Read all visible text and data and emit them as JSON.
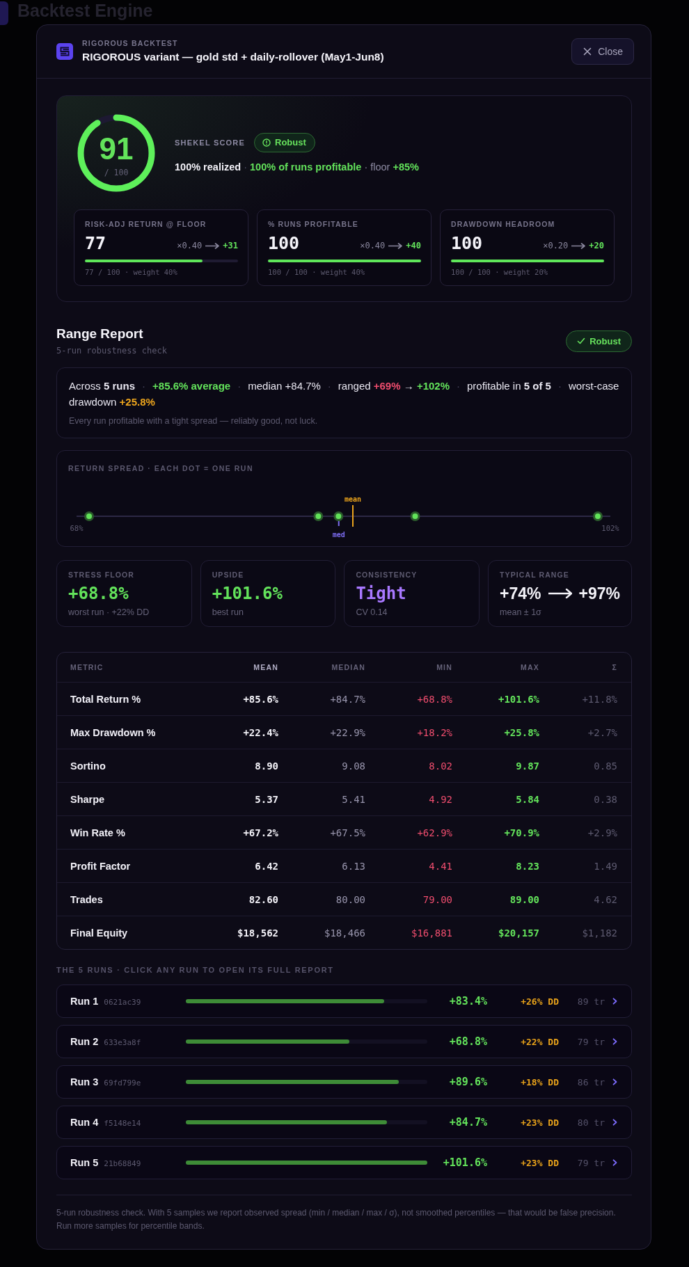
{
  "background": {
    "title": "Backtest Engine"
  },
  "modal": {
    "eyebrow": "RIGOROUS BACKTEST",
    "title": "RIGOROUS variant — gold std + daily-rollover (May1-Jun8)",
    "close": "Close"
  },
  "score": {
    "label": "SHEKEL SCORE",
    "value": "91",
    "out_of": "/ 100",
    "level": 0.91,
    "badge": "Robust",
    "summary": [
      {
        "text": "100% realized",
        "kind": "strong"
      },
      {
        "text": " · ",
        "kind": "dim"
      },
      {
        "text": "100% of runs profitable",
        "kind": "gain"
      },
      {
        "text": " · floor ",
        "kind": "muted"
      },
      {
        "text": "+85%",
        "kind": "gain"
      }
    ],
    "components": [
      {
        "label": "RISK-ADJ RETURN @ FLOOR",
        "value": "77",
        "factor": "×0.40",
        "points": "+31",
        "level": 0.77,
        "footer": "77 / 100 · weight 40%"
      },
      {
        "label": "% RUNS PROFITABLE",
        "value": "100",
        "factor": "×0.40",
        "points": "+40",
        "level": 1,
        "footer": "100 / 100 · weight 40%"
      },
      {
        "label": "DRAWDOWN HEADROOM",
        "value": "100",
        "factor": "×0.20",
        "points": "+20",
        "level": 1,
        "footer": "100 / 100 · weight 20%"
      }
    ]
  },
  "range_report": {
    "title": "Range Report",
    "subtitle": "5-run robustness check",
    "badge": "Robust",
    "summary": {
      "separator": "·",
      "segments": [
        [
          {
            "text": "Across **5 runs**",
            "kind": "plain"
          }
        ],
        [
          {
            "text": "+85.6% average",
            "kind": "gain"
          }
        ],
        [
          {
            "text": "median +84.7%",
            "kind": "plain"
          }
        ],
        [
          {
            "text": "ranged ",
            "kind": "plain"
          },
          {
            "text": "+69%",
            "kind": "loss"
          },
          {
            "text": " → ",
            "kind": "plain"
          },
          {
            "text": "+102%",
            "kind": "gain"
          }
        ],
        [
          {
            "text": "profitable in **5 of 5**",
            "kind": "plain"
          }
        ],
        [
          {
            "text": "worst-case drawdown ",
            "kind": "plain"
          },
          {
            "text": "+25.8%",
            "kind": "warn"
          }
        ]
      ],
      "note": "Every run profitable with a tight spread — reliably good, not luck."
    },
    "spread": {
      "title": "RETURN SPREAD · EACH DOT = ONE RUN",
      "min_label": "68%",
      "max_label": "102%",
      "markers": [
        {
          "label": "mean",
          "color": "#eaa31c"
        },
        {
          "label": "med",
          "color": "#7c6cf0"
        }
      ]
    },
    "stats": [
      {
        "kind": "gain",
        "label": "STRESS FLOOR",
        "value": "+68.8%",
        "caption": "worst run · +22% DD"
      },
      {
        "kind": "gain",
        "label": "UPSIDE",
        "value": "+101.6%",
        "caption": "best run"
      },
      {
        "kind": "accent",
        "label": "CONSISTENCY",
        "value": "Tight",
        "caption": "CV 0.14"
      },
      {
        "kind": "range",
        "label": "TYPICAL RANGE",
        "from": "+74%",
        "to": "+97%",
        "caption": "mean ± 1σ"
      }
    ]
  },
  "table": {
    "columns": [
      {
        "label": "METRIC",
        "kind": "label"
      },
      {
        "label": "MEAN",
        "kind": "strong"
      },
      {
        "label": "MEDIAN",
        "kind": "muted"
      },
      {
        "label": "MIN",
        "kind": "loss"
      },
      {
        "label": "MAX",
        "kind": "gain"
      },
      {
        "label": "Σ",
        "kind": "dim"
      }
    ],
    "rows": [
      {
        "metric": "Total Return %",
        "values": [
          "+85.6%",
          "+84.7%",
          "+68.8%",
          "+101.6%",
          "+11.8%"
        ]
      },
      {
        "metric": "Max Drawdown %",
        "values": [
          "+22.4%",
          "+22.9%",
          "+18.2%",
          "+25.8%",
          "+2.7%"
        ]
      },
      {
        "metric": "Sortino",
        "values": [
          "8.90",
          "9.08",
          "8.02",
          "9.87",
          "0.85"
        ]
      },
      {
        "metric": "Sharpe",
        "values": [
          "5.37",
          "5.41",
          "4.92",
          "5.84",
          "0.38"
        ]
      },
      {
        "metric": "Win Rate %",
        "values": [
          "+67.2%",
          "+67.5%",
          "+62.9%",
          "+70.9%",
          "+2.9%"
        ]
      },
      {
        "metric": "Profit Factor",
        "values": [
          "6.42",
          "6.13",
          "4.41",
          "8.23",
          "1.49"
        ]
      },
      {
        "metric": "Trades",
        "values": [
          "82.60",
          "80.00",
          "79.00",
          "89.00",
          "4.62"
        ]
      },
      {
        "metric": "Final Equity",
        "values": [
          "$18,562",
          "$18,466",
          "$16,881",
          "$20,157",
          "$1,182"
        ]
      }
    ]
  },
  "runs_heading": "THE 5 RUNS · CLICK ANY RUN TO OPEN ITS FULL REPORT",
  "runs": [
    {
      "name": "Run 1",
      "hash": "0621ac39",
      "level": 0.821,
      "return": "+83.4%",
      "drawdown": "+26% DD",
      "trades": "89 tr"
    },
    {
      "name": "Run 2",
      "hash": "633e3a8f",
      "level": 0.677,
      "return": "+68.8%",
      "drawdown": "+22% DD",
      "trades": "79 tr"
    },
    {
      "name": "Run 3",
      "hash": "69fd799e",
      "level": 0.882,
      "return": "+89.6%",
      "drawdown": "+18% DD",
      "trades": "86 tr"
    },
    {
      "name": "Run 4",
      "hash": "f5148e14",
      "level": 0.834,
      "return": "+84.7%",
      "drawdown": "+23% DD",
      "trades": "80 tr"
    },
    {
      "name": "Run 5",
      "hash": "21b68849",
      "level": 1,
      "return": "+101.6%",
      "drawdown": "+23% DD",
      "trades": "79 tr"
    }
  ],
  "footnote": "5-run robustness check. With 5 samples we report observed spread (min / median / max / σ), not smoothed percentiles — that would be false precision. Run more samples for percentile bands."
}
